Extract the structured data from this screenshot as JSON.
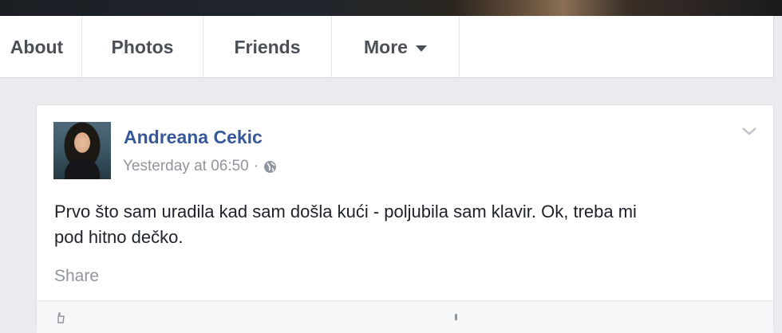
{
  "nav": {
    "tabs": [
      {
        "label": "About"
      },
      {
        "label": "Photos"
      },
      {
        "label": "Friends"
      },
      {
        "label": "More"
      }
    ]
  },
  "post": {
    "author": "Andreana Cekic",
    "timestamp": "Yesterday at 06:50",
    "separator": "·",
    "privacy_icon": "globe-icon",
    "text_line_1": "Prvo što sam uradila kad sam došla kući - poljubila sam klavir. Ok, treba mi",
    "text_line_2": "pod hitno dečko.",
    "share_label": "Share"
  },
  "colors": {
    "link_blue": "#365899",
    "meta_gray": "#90949c",
    "tab_text": "#4b4f56",
    "page_bg": "#e9ebee"
  }
}
